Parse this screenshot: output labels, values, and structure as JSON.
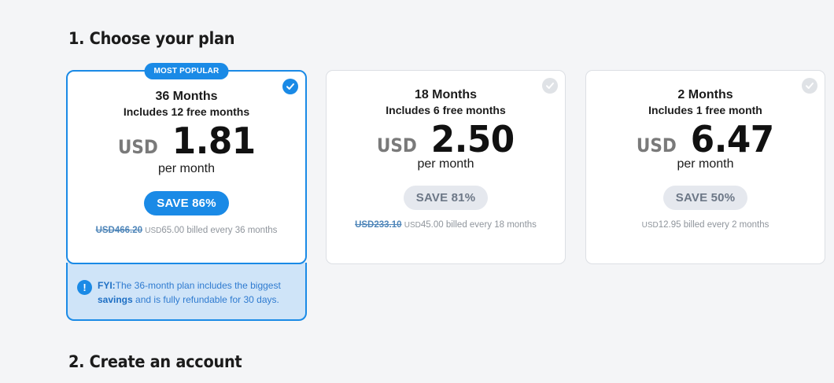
{
  "steps": {
    "choose_plan": "1. Choose your plan",
    "create_account": "2. Create an account"
  },
  "colors": {
    "accent": "#1a8ae6",
    "fyi_background": "#cfe4f8",
    "inactive_pill": "#e5e8ee"
  },
  "plans": [
    {
      "badge": "MOST POPULAR",
      "duration": "36 Months",
      "free_months": "Includes 12 free months",
      "currency": "USD",
      "price": "1.81",
      "per_month": "per month",
      "save": "SAVE 86%",
      "original_price": "USD466.20",
      "billed_currency": "USD",
      "billed_amount": "65.00",
      "billed_text": "billed every 36 months",
      "selected": true,
      "check_icon": "check-circle-icon"
    },
    {
      "duration": "18 Months",
      "free_months": "Includes 6 free months",
      "currency": "USD",
      "price": "2.50",
      "per_month": "per month",
      "save": "SAVE 81%",
      "original_price": "USD233.10",
      "billed_currency": "USD",
      "billed_amount": "45.00",
      "billed_text": "billed every 18 months",
      "selected": false,
      "check_icon": "check-circle-icon"
    },
    {
      "duration": "2 Months",
      "free_months": "Includes 1 free month",
      "currency": "USD",
      "price": "6.47",
      "per_month": "per month",
      "save": "SAVE 50%",
      "billed_currency": "USD",
      "billed_amount": "12.95",
      "billed_text": "billed every 2 months",
      "selected": false,
      "check_icon": "check-circle-icon"
    }
  ],
  "fyi": {
    "icon": "exclamation-icon",
    "icon_glyph": "!",
    "label": "FYI:",
    "text_before": "The 36-month plan includes the biggest",
    "bold": "savings",
    "text_after": "and is fully refundable for 30 days."
  }
}
